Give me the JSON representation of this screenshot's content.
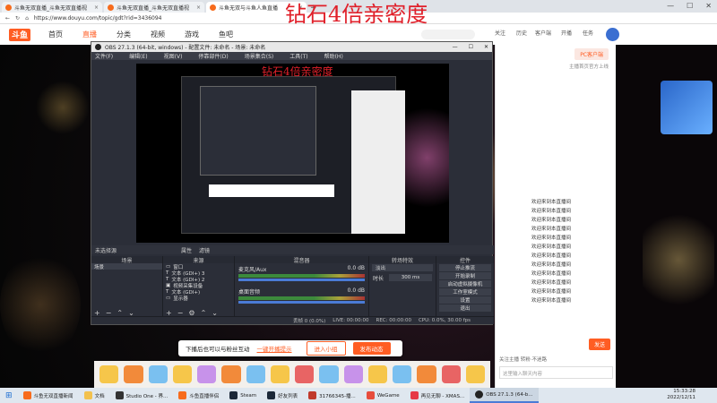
{
  "browser": {
    "tabs": [
      {
        "label": "斗鱼无双直播_斗鱼无双直播视",
        "active": false
      },
      {
        "label": "斗鱼无双直播_斗鱼无双直播视",
        "active": false
      },
      {
        "label": "斗鱼无双与斗鱼人鱼直播",
        "active": true
      }
    ],
    "url": "https://www.douyu.com/topic/gdt?rid=3436094"
  },
  "overlay_title": "钻石4倍亲密度",
  "site": {
    "logo": "斗鱼",
    "nav": [
      "首页",
      "直播",
      "分类",
      "视频",
      "游戏",
      "鱼吧"
    ],
    "header_icons": [
      "关注",
      "历史",
      "客户端",
      "开播",
      "任务"
    ]
  },
  "obs": {
    "title": "OBS 27.1.3 (64-bit, windows) - 配置文件: 未命名 - 场景: 未命名",
    "menu": [
      "文件(F)",
      "编辑(E)",
      "视图(V)",
      "停靠部件(D)",
      "场景集合(S)",
      "工具(T)",
      "帮助(H)"
    ],
    "preview_title": "钻石4倍亲密度",
    "toolbar": [
      "未选择源",
      "属性",
      "滤镜"
    ],
    "docks": {
      "scenes": {
        "header": "场景",
        "items": [
          "场景"
        ]
      },
      "sources": {
        "header": "来源",
        "items": [
          "窗口",
          "文本 (GDI+) 3",
          "文本 (GDI+) 2",
          "视频采集设备",
          "文本 (GDI+)",
          "显示器"
        ]
      },
      "mixer": {
        "header": "混音器",
        "tracks": [
          {
            "name": "桌面音频",
            "db": "0.0 dB"
          },
          {
            "name": "麦克风/Aux",
            "db": "0.0 dB"
          }
        ]
      },
      "transitions": {
        "header": "转场特效",
        "type": "淡出",
        "duration_label": "时长",
        "duration": "300 ms"
      },
      "controls": {
        "header": "控件",
        "buttons": [
          "停止推流",
          "开始录制",
          "启动虚拟摄像机",
          "工作室模式",
          "设置",
          "退出"
        ]
      }
    },
    "status": [
      "丢帧 0 (0.0%)",
      "LIVE: 00:00:00",
      "REC: 00:00:00",
      "CPU: 0.0%, 30.00 fps"
    ]
  },
  "chat": {
    "pc_button": "PC客户端",
    "pc_sub": "主播首页官方上线",
    "messages": [
      "欢迎来到本直播间",
      "欢迎来到本直播间",
      "欢迎来到本直播间",
      "欢迎来到本直播间",
      "欢迎来到本直播间",
      "欢迎来到本直播间",
      "欢迎来到本直播间",
      "欢迎来到本直播间",
      "欢迎来到本直播间",
      "欢迎来到本直播间",
      "欢迎来到本直播间",
      "欢迎来到本直播间"
    ],
    "send": "发送",
    "input_placeholder": "这里输入聊天内容",
    "follow_line": "关注主播  转粉·不迷路"
  },
  "popup": {
    "text": "下播后也可以与粉丝互动",
    "link": "一键开播提示",
    "btn1": "进入小组",
    "btn2": "发布动态"
  },
  "taskbar": {
    "items": [
      "斗鱼无双直播新闻",
      "文档",
      "Studio One - 界...",
      "斗鱼直播伴侣",
      "Steam",
      "好友列表",
      "31766345-播...",
      "WeGame",
      "再见无聊 - XMAS...",
      "OBS 27.1.3 (64-b..."
    ],
    "time": "15:33:28",
    "date": "2022/12/11"
  }
}
